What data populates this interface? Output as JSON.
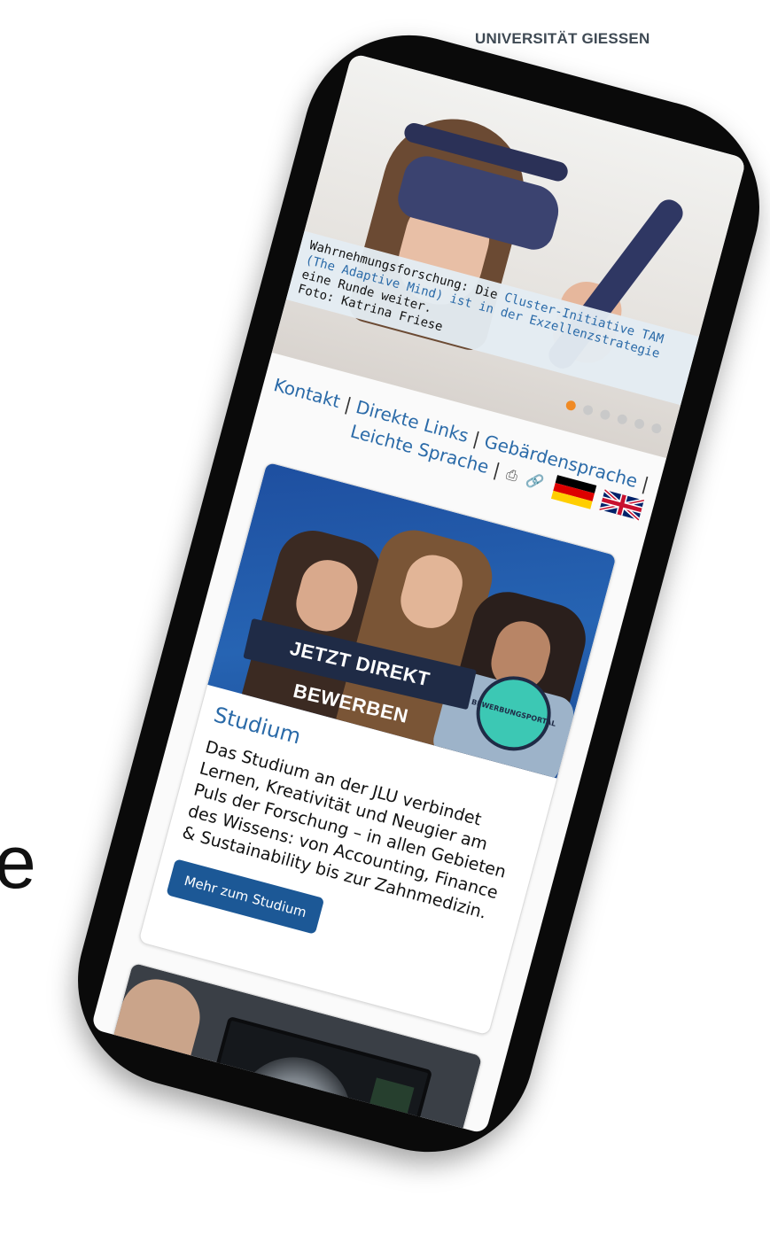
{
  "university_name": "UNIVERSITÄT GIESSEN",
  "side_letter": "e",
  "hero": {
    "caption_prefix": "Wahrnehmungsforschung: Die ",
    "caption_link": "Cluster-Initiative TAM (The Adaptive Mind) ist in der Exzellenzstrategie",
    "caption_suffix": " eine Runde weiter.",
    "photo_credit": "Foto: Katrina Friese",
    "slides_total": 6,
    "active_slide": 1
  },
  "nav_links": {
    "kontakt": "Kontakt",
    "direkte_links": "Direkte Links",
    "gebaerdensprache": "Gebärdensprache",
    "leichte_sprache": "Leichte Sprache",
    "separator": "|"
  },
  "icons": {
    "print": "print-icon",
    "link": "link-icon",
    "flag_de": "german-flag-icon",
    "flag_en": "uk-flag-icon"
  },
  "studium_card": {
    "banner": "JETZT DIREKT BEWERBEN",
    "badge": "BEWERBUNGSPORTAL",
    "title": "Studium",
    "text": "Das Studium an der JLU verbindet Lernen, Kreativität und Neugier am Puls der Forschung – in allen Gebieten des Wissens: von Accounting, Finance & Sustainability bis zur Zahnmedizin.",
    "button": "Mehr zum Studium"
  },
  "colors": {
    "link_blue": "#2a6aa8",
    "button_blue": "#1c5896",
    "active_dot": "#f08a24"
  }
}
